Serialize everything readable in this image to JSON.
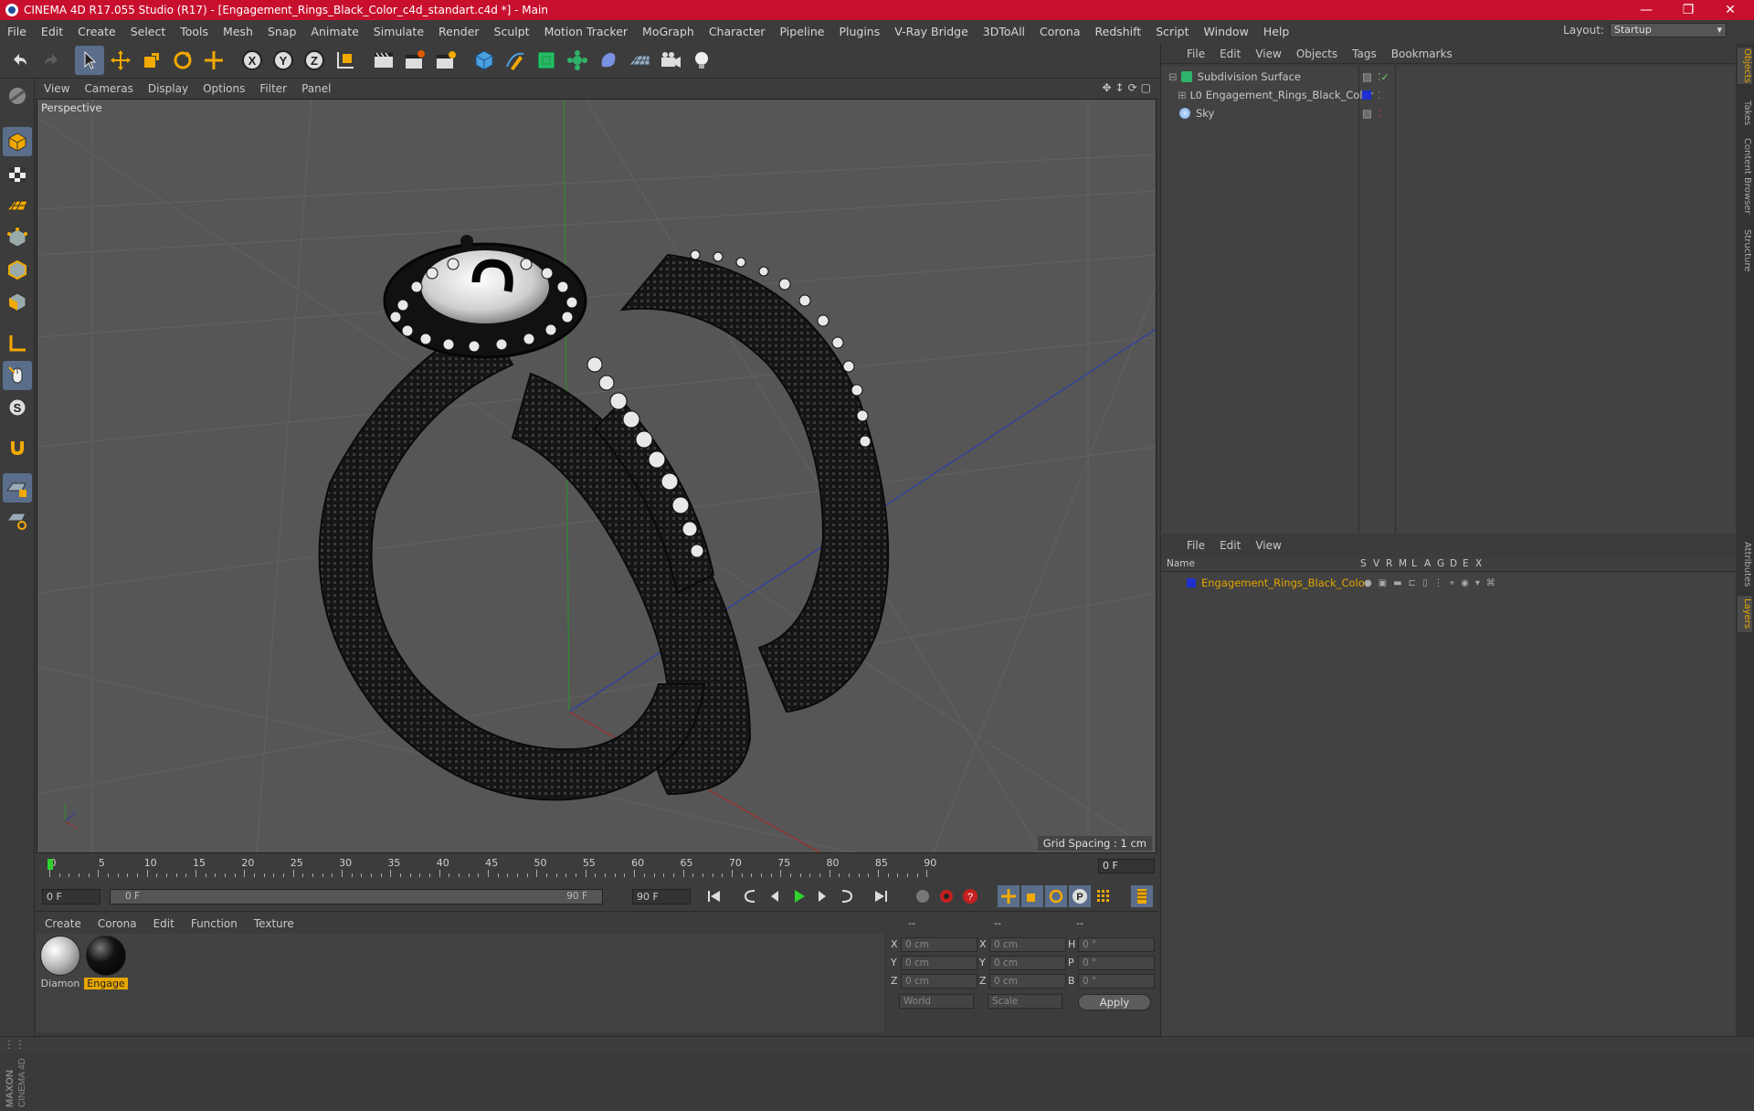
{
  "window": {
    "title": "CINEMA 4D R17.055 Studio (R17) - [Engagement_Rings_Black_Color_c4d_standart.c4d *] - Main"
  },
  "menu": [
    "File",
    "Edit",
    "Create",
    "Select",
    "Tools",
    "Mesh",
    "Snap",
    "Animate",
    "Simulate",
    "Render",
    "Sculpt",
    "Motion Tracker",
    "MoGraph",
    "Character",
    "Pipeline",
    "Plugins",
    "V-Ray Bridge",
    "3DToAll",
    "Corona",
    "Redshift",
    "Script",
    "Window",
    "Help"
  ],
  "layout": {
    "label": "Layout:",
    "value": "Startup"
  },
  "viewport": {
    "menu": [
      "View",
      "Cameras",
      "Display",
      "Options",
      "Filter",
      "Panel"
    ],
    "label": "Perspective",
    "grid_spacing": "Grid Spacing : 1 cm"
  },
  "timeline": {
    "ticks": [
      "0",
      "5",
      "10",
      "15",
      "20",
      "25",
      "30",
      "35",
      "40",
      "45",
      "50",
      "55",
      "60",
      "65",
      "70",
      "75",
      "80",
      "85",
      "90"
    ],
    "current_frame": "0 F",
    "start_field": "0 F",
    "slider_start": "0 F",
    "slider_end": "90 F",
    "end_field": "90 F"
  },
  "materials": {
    "menu": [
      "Create",
      "Corona",
      "Edit",
      "Function",
      "Texture"
    ],
    "items": [
      {
        "name": "Diamon",
        "color": "#bdbdbd"
      },
      {
        "name": "Engage",
        "color": "#111111"
      }
    ]
  },
  "coords": {
    "headers": [
      "--",
      "--",
      "--"
    ],
    "labels_left": [
      "X",
      "Y",
      "Z"
    ],
    "labels_mid": [
      "X",
      "Y",
      "Z"
    ],
    "labels_right": [
      "H",
      "P",
      "B"
    ],
    "pos": [
      "0 cm",
      "0 cm",
      "0 cm"
    ],
    "size": [
      "0 cm",
      "0 cm",
      "0 cm"
    ],
    "rot": [
      "0 °",
      "0 °",
      "0 °"
    ],
    "mode1": "World",
    "mode2": "Scale",
    "apply": "Apply"
  },
  "objects": {
    "menu": [
      "File",
      "Edit",
      "View",
      "Objects",
      "Tags",
      "Bookmarks"
    ],
    "items": [
      {
        "name": "Subdivision Surface",
        "icon": "subdivision-icon"
      },
      {
        "name": "Engagement_Rings_Black_Color",
        "icon": "null-object-icon"
      },
      {
        "name": "Sky",
        "icon": "sky-icon"
      }
    ]
  },
  "layers": {
    "menu": [
      "File",
      "Edit",
      "View"
    ],
    "headers": [
      "Name",
      "S",
      "V",
      "R",
      "M",
      "L",
      "A",
      "G",
      "D",
      "E",
      "X"
    ],
    "items": [
      {
        "name": "Engagement_Rings_Black_Color",
        "color": "#1f2fd0"
      }
    ]
  },
  "side_tabs": [
    "Objects",
    "Takes",
    "Content Browser",
    "Structure"
  ],
  "side_tabs_lower": [
    "Attributes",
    "Layers"
  ],
  "brand": {
    "maxon": "MAXON",
    "product": "CINEMA 4D"
  },
  "colors": {
    "accent": "#e4a500",
    "titlebar": "#c8102e",
    "selected_tool": "#5a6e8c"
  }
}
